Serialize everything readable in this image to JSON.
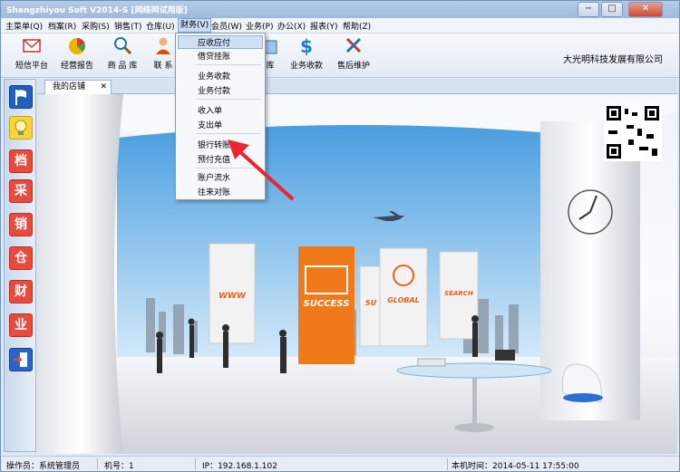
{
  "window": {
    "title": "Shangzhiyou Soft V2014-S [网络网试用版]",
    "buttons": [
      "−",
      "□",
      "✕"
    ]
  },
  "menu": [
    {
      "label": "主菜单(Q)",
      "active": false
    },
    {
      "label": "档案(R)",
      "active": false
    },
    {
      "label": "采购(S)",
      "active": false
    },
    {
      "label": "销售(T)",
      "active": false
    },
    {
      "label": "仓库(U)",
      "active": false
    },
    {
      "label": "财务(V)",
      "active": true
    },
    {
      "label": "会员(W)",
      "active": false
    },
    {
      "label": "业务(P)",
      "active": false
    },
    {
      "label": "办公(X)",
      "active": false
    },
    {
      "label": "报表(Y)",
      "active": false
    },
    {
      "label": "帮助(Z)",
      "active": false
    }
  ],
  "toolbar": {
    "items": [
      {
        "label": "短信平台",
        "icon": "envelope-icon"
      },
      {
        "label": "经营报告",
        "icon": "pie-chart-icon"
      },
      {
        "label": "商 品 库",
        "icon": "magnifier-icon"
      },
      {
        "label": "联 系",
        "icon": "contact-icon"
      },
      {
        "label": "库",
        "icon": "warehouse-icon"
      },
      {
        "label": "业务收款",
        "icon": "dollar-icon"
      },
      {
        "label": "售后维护",
        "icon": "tools-icon"
      }
    ],
    "company": "大光明科技发展有限公司"
  },
  "finance_dropdown": {
    "items": [
      "应收应付",
      "借贷挂账",
      "业务收款",
      "业务付款",
      "收入单",
      "支出单",
      "银行转账",
      "预付充值",
      "账户流水",
      "往来对账"
    ]
  },
  "sidebar": {
    "items": [
      {
        "label": "",
        "icon": "flag-icon"
      },
      {
        "label": "",
        "icon": "lightbulb-icon"
      },
      {
        "label": "档",
        "icon": "archive-icon"
      },
      {
        "label": "采",
        "icon": "purchase-icon"
      },
      {
        "label": "销",
        "icon": "sales-icon"
      },
      {
        "label": "仓",
        "icon": "warehouse-icon"
      },
      {
        "label": "财",
        "icon": "finance-icon"
      },
      {
        "label": "业",
        "icon": "business-icon"
      },
      {
        "label": "",
        "icon": "exit-icon"
      }
    ]
  },
  "tabs": [
    {
      "label": "我的店铺",
      "close": "✕"
    }
  ],
  "scene": {
    "panels": [
      "WWW",
      "SUCCESS",
      "SU",
      "GLOBAL",
      "SEARCH"
    ]
  },
  "status": {
    "operator": "操作员：系统管理员",
    "machine": "机号：1",
    "ip": "IP：192.168.1.102",
    "time": "本机时间：2014-05-11 17:55:00"
  }
}
